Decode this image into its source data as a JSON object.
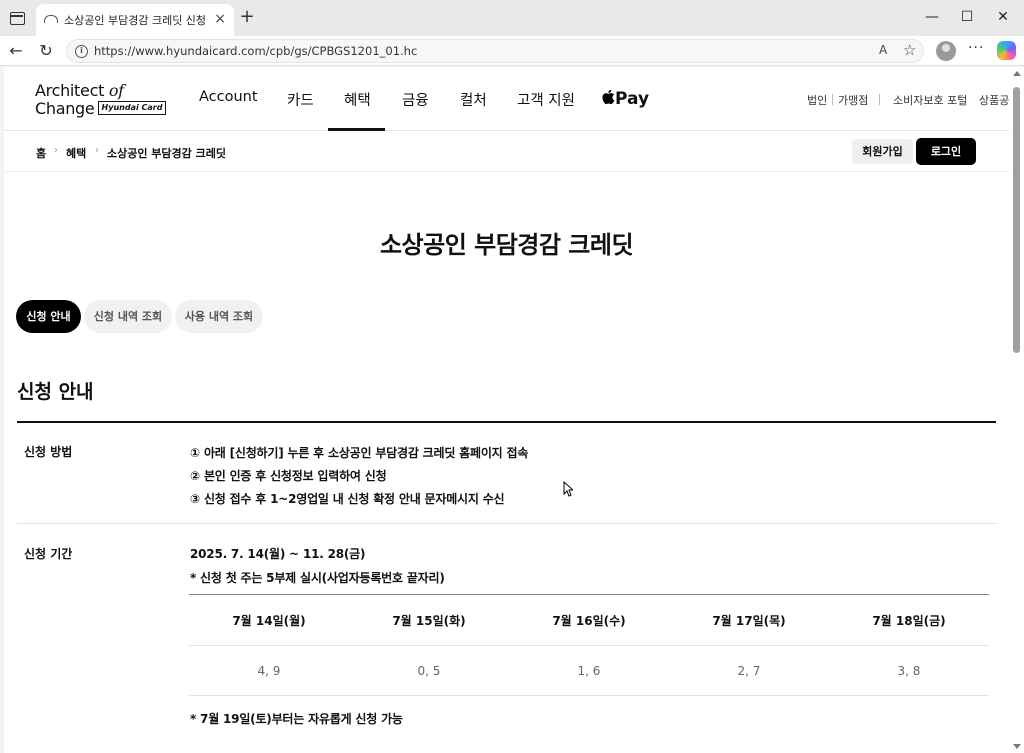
{
  "browser": {
    "tab_title": "소상공인 부담경감 크레딧 신청 등",
    "tab_close": "×",
    "new_tab": "+",
    "url": "https://www.hyundaicard.com/cpb/gs/CPBGS1201_01.hc",
    "read_aloud": "A",
    "favorite": "☆",
    "more": "···",
    "minimize": "—",
    "maximize": "☐",
    "close": "✕",
    "back": "←",
    "refresh": "↻",
    "info": "i"
  },
  "logo": {
    "line1_a": "Architect ",
    "line1_b": "of",
    "line2": "Change",
    "badge": "Hyundai Card"
  },
  "gnb": {
    "items": [
      "Account",
      "카드",
      "혜택",
      "금융",
      "컬처",
      "고객 지원"
    ],
    "active": "혜택",
    "apple_pay": "Pay",
    "apple_logo": "",
    "util": [
      "법인",
      "가맹점",
      "소비자보호 포털",
      "상품공"
    ]
  },
  "breadcrumb": [
    "홈",
    "혜택",
    "소상공인 부담경감 크레딧"
  ],
  "breadcrumb_sep": "›",
  "auth": {
    "join": "회원가입",
    "login": "로그인"
  },
  "page_title": "소상공인 부담경감 크레딧",
  "tabs": [
    {
      "label": "신청 안내",
      "active": true
    },
    {
      "label": "신청 내역 조회",
      "active": false
    },
    {
      "label": "사용 내역 조회",
      "active": false
    }
  ],
  "section_title": "신청 안내",
  "method": {
    "label": "신청 방법",
    "steps": [
      "① 아래 [신청하기] 누른 후 소상공인 부담경감 크레딧 홈페이지 접속",
      "② 본인 인증 후 신청정보 입력하여 신청",
      "③ 신청 접수 후 1~2영업일 내 신청 확정 안내 문자메시지 수신"
    ]
  },
  "period": {
    "label": "신청 기간",
    "range": "2025. 7. 14(월) ~ 11. 28(금)",
    "note1": "* 신청 첫 주는 5부제 실시(사업자등록번호 끝자리)",
    "schedule": {
      "days": [
        "7월 14일(월)",
        "7월 15일(화)",
        "7월 16일(수)",
        "7월 17일(목)",
        "7월 18일(금)"
      ],
      "digits": [
        "4, 9",
        "0, 5",
        "1, 6",
        "2, 7",
        "3, 8"
      ]
    },
    "note2": "* 7월 19일(토)부터는 자유롭게 신청 가능"
  }
}
